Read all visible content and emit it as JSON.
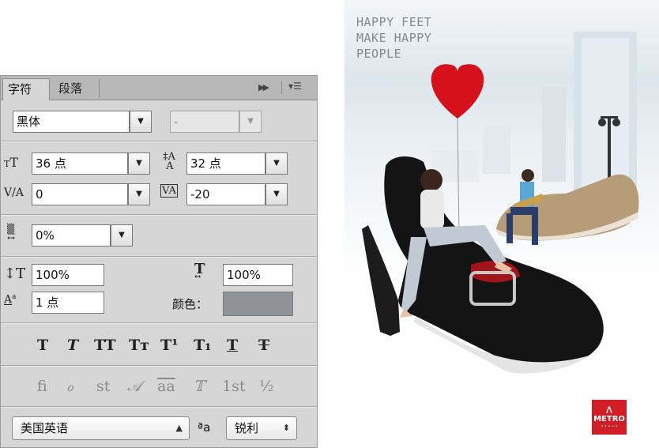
{
  "panel": {
    "tabs": [
      {
        "label": "字符",
        "active": true
      },
      {
        "label": "段落",
        "active": false
      }
    ],
    "font_family": "黑体",
    "font_style": "-",
    "font_size": "36 点",
    "leading": "32 点",
    "kerning": "0",
    "tracking": "-20",
    "tsume": "0%",
    "vertical_scale": "100%",
    "horizontal_scale": "100%",
    "baseline_shift": "1 点",
    "color_label": "颜色：",
    "color_value": "#8f9296",
    "style_buttons": [
      "T",
      "T",
      "TT",
      "Tт",
      "T¹",
      "T₁",
      "T",
      "T"
    ],
    "opentype_buttons": [
      "fi",
      "ℴ",
      "st",
      "𝒜",
      "aa",
      "𝕋",
      "1st",
      "½"
    ],
    "language": "美国英语",
    "aa_icon": "ªa",
    "antialias": "锐利"
  },
  "poster": {
    "headline": [
      "HAPPY FEET",
      "MAKE HAPPY",
      "PEOPLE"
    ],
    "logo_text": "METRO"
  }
}
